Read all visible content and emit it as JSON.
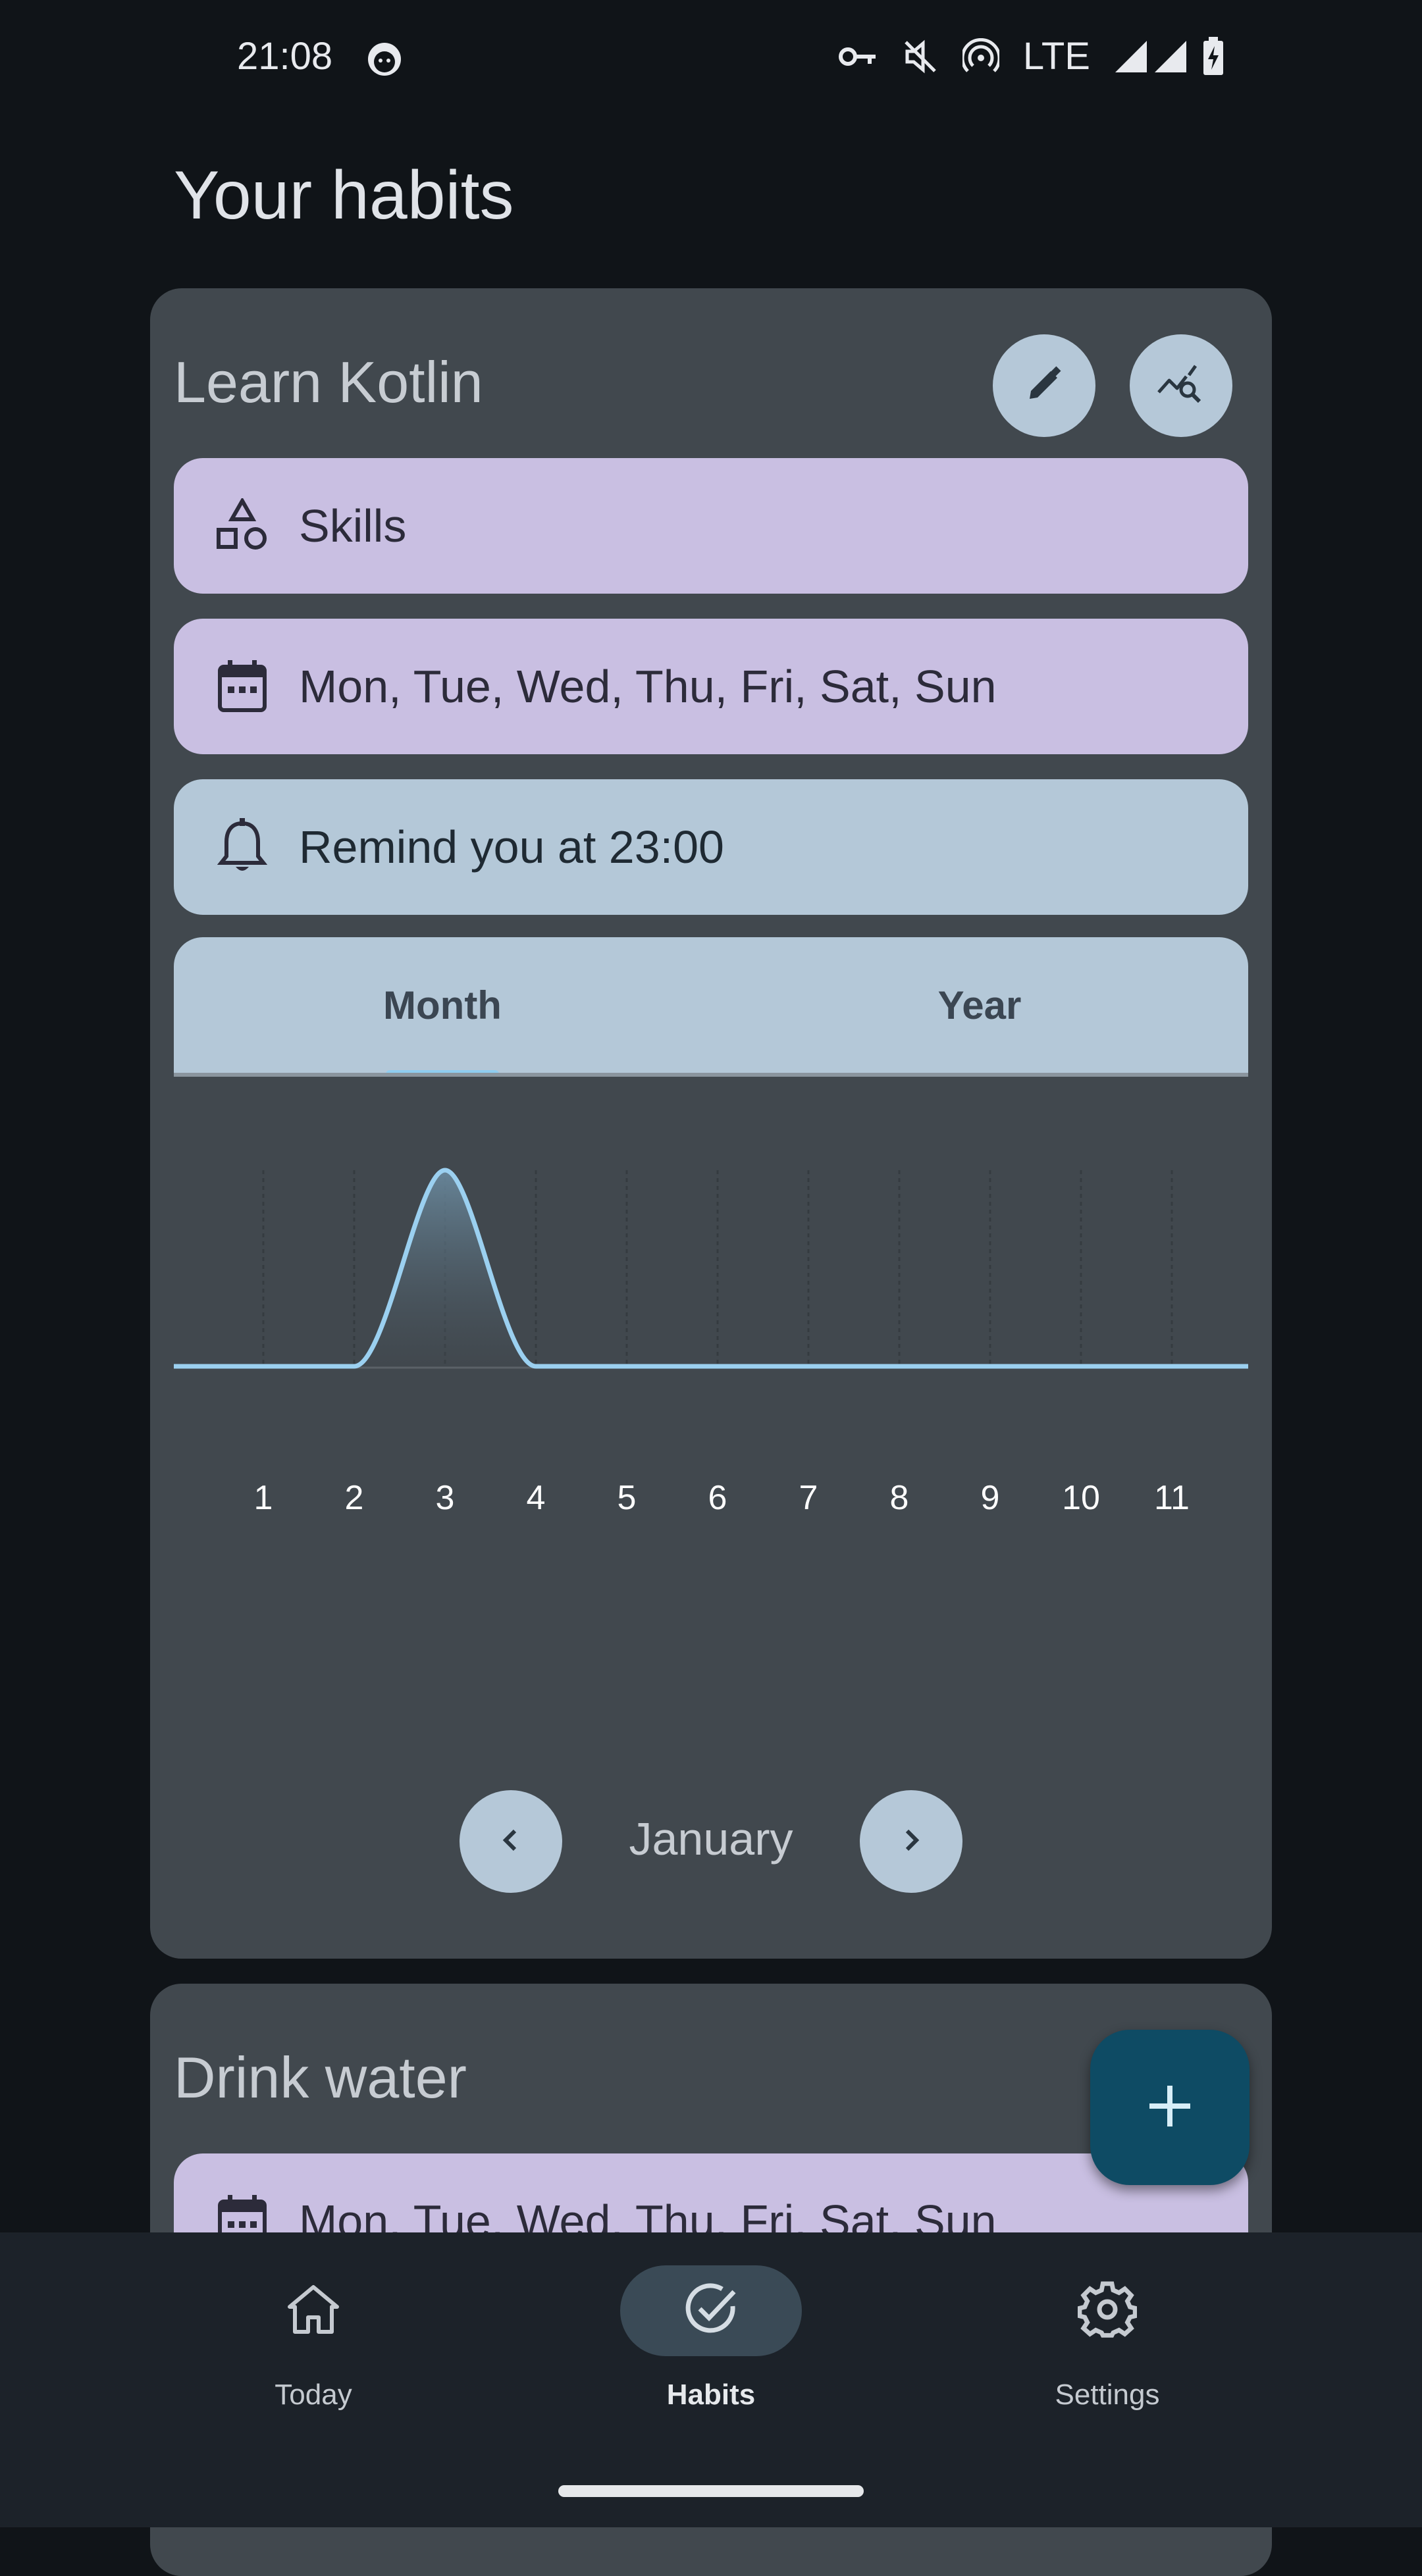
{
  "status_bar": {
    "time": "21:08",
    "network": "LTE",
    "icons": [
      "face-icon",
      "vpn-key-icon",
      "mute-icon",
      "hotspot-icon",
      "signal-icon",
      "signal-icon-2",
      "battery-charging-icon"
    ]
  },
  "page": {
    "title": "Your habits"
  },
  "habits": [
    {
      "title": "Learn Kotlin",
      "category": {
        "icon": "shapes-icon",
        "label": "Skills"
      },
      "days": {
        "icon": "calendar-icon",
        "label": "Mon, Tue, Wed, Thu, Fri, Sat, Sun"
      },
      "reminder": {
        "icon": "bell-icon",
        "label": "Remind you at 23:00"
      },
      "tabs": [
        {
          "label": "Month",
          "selected": true
        },
        {
          "label": "Year",
          "selected": false
        }
      ],
      "period": {
        "label": "January"
      },
      "actions": {
        "edit_icon": "edit-icon",
        "stats_icon": "query-stats-icon"
      }
    },
    {
      "title": "Drink water",
      "days": {
        "icon": "calendar-icon",
        "label": "Mon, Tue, Wed, Thu, Fri, Sat, Sun"
      }
    }
  ],
  "chart_data": {
    "type": "area",
    "x": [
      1,
      2,
      3,
      4,
      5,
      6,
      7,
      8,
      9,
      10,
      11
    ],
    "values": [
      0,
      0,
      1,
      0,
      0,
      0,
      0,
      0,
      0,
      0,
      0
    ],
    "x_ticks": [
      "1",
      "2",
      "3",
      "4",
      "5",
      "6",
      "7",
      "8",
      "9",
      "10",
      "11"
    ],
    "smooth": true,
    "grid": "vertical-dashed",
    "line_color": "#9bd0f0"
  },
  "fab": {
    "icon": "plus-icon"
  },
  "bottom_nav": {
    "items": [
      {
        "label": "Today",
        "icon": "home-icon",
        "selected": false
      },
      {
        "label": "Habits",
        "icon": "check-circle-icon",
        "selected": true
      },
      {
        "label": "Settings",
        "icon": "gear-icon",
        "selected": false
      }
    ]
  },
  "colors": {
    "background": "#101418",
    "card": "#41484e",
    "chip_purple": "#c9bfe2",
    "chip_blue": "#b4c8d8",
    "fab": "#0e4b64",
    "accent_line": "#9bd0f0"
  }
}
